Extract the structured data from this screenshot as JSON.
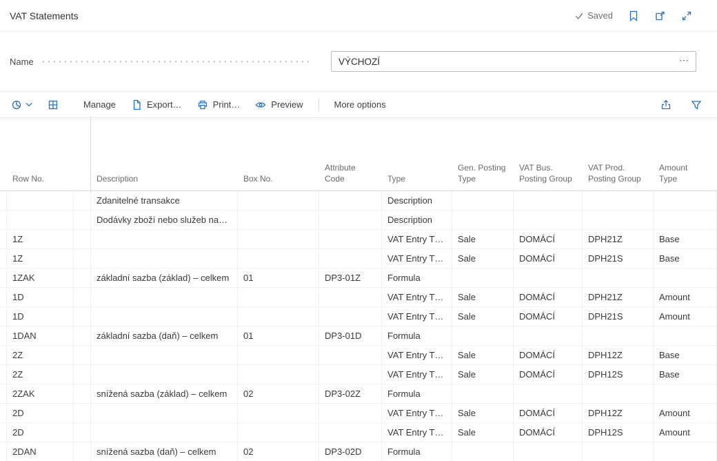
{
  "header": {
    "title": "VAT Statements",
    "saved_label": "Saved"
  },
  "name_field": {
    "label": "Name",
    "value": "VÝCHOZÍ",
    "assist_edit": "⋯"
  },
  "toolbar": {
    "manage": "Manage",
    "export": "Export…",
    "print": "Print…",
    "preview": "Preview",
    "more_options": "More options"
  },
  "table": {
    "columns": [
      "Row No.",
      "Description",
      "Box No.",
      "Attribute Code",
      "Type",
      "Gen. Posting\nType",
      "VAT Bus.\nPosting Group",
      "VAT Prod.\nPosting Group",
      "Amount\nType"
    ],
    "rows": [
      [
        "",
        "Zdanitelné transakce",
        "",
        "",
        "Description",
        "",
        "",
        "",
        ""
      ],
      [
        "",
        "Dodávky zboží nebo služeb na…",
        "",
        "",
        "Description",
        "",
        "",
        "",
        ""
      ],
      [
        "1Z",
        "",
        "",
        "",
        "VAT Entry T…",
        "Sale",
        "DOMÁCÍ",
        "DPH21Z",
        "Base"
      ],
      [
        "1Z",
        "",
        "",
        "",
        "VAT Entry T…",
        "Sale",
        "DOMÁCÍ",
        "DPH21S",
        "Base"
      ],
      [
        "1ZAK",
        "základní sazba (základ) – celkem",
        "01",
        "DP3-01Z",
        "Formula",
        "",
        "",
        "",
        ""
      ],
      [
        "1D",
        "",
        "",
        "",
        "VAT Entry T…",
        "Sale",
        "DOMÁCÍ",
        "DPH21Z",
        "Amount"
      ],
      [
        "1D",
        "",
        "",
        "",
        "VAT Entry T…",
        "Sale",
        "DOMÁCÍ",
        "DPH21S",
        "Amount"
      ],
      [
        "1DAN",
        "základní sazba (daň) – celkem",
        "01",
        "DP3-01D",
        "Formula",
        "",
        "",
        "",
        ""
      ],
      [
        "2Z",
        "",
        "",
        "",
        "VAT Entry T…",
        "Sale",
        "DOMÁCÍ",
        "DPH12Z",
        "Base"
      ],
      [
        "2Z",
        "",
        "",
        "",
        "VAT Entry T…",
        "Sale",
        "DOMÁCÍ",
        "DPH12S",
        "Base"
      ],
      [
        "2ZAK",
        "snížená sazba (základ) – celkem",
        "02",
        "DP3-02Z",
        "Formula",
        "",
        "",
        "",
        ""
      ],
      [
        "2D",
        "",
        "",
        "",
        "VAT Entry T…",
        "Sale",
        "DOMÁCÍ",
        "DPH12Z",
        "Amount"
      ],
      [
        "2D",
        "",
        "",
        "",
        "VAT Entry T…",
        "Sale",
        "DOMÁCÍ",
        "DPH12S",
        "Amount"
      ],
      [
        "2DAN",
        "snížená sazba (daň) – celkem",
        "02",
        "DP3-02D",
        "Formula",
        "",
        "",
        "",
        ""
      ]
    ]
  },
  "colors": {
    "accent_blue": "#2472c8",
    "text_dark": "#3a3a3a",
    "text_gray": "#6b6b6b",
    "border": "#ededed"
  }
}
